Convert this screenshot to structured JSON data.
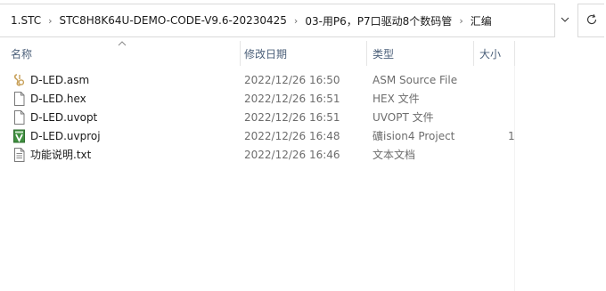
{
  "breadcrumb": {
    "items": [
      "1.STC",
      "STC8H8K64U-DEMO-CODE-V9.6-20230425",
      "03-用P6，P7口驱动8个数码管",
      "汇编"
    ],
    "separator": "›",
    "dropdown_icon": "chevron-down-icon",
    "refresh_icon": "refresh-icon"
  },
  "columns": {
    "name": "名称",
    "date": "修改日期",
    "type": "类型",
    "size": "大小",
    "sort_indicator": "sort-ascending-icon"
  },
  "files": [
    {
      "name": "D-LED.asm",
      "date": "2022/12/26 16:50",
      "type": "ASM Source File",
      "size": "",
      "icon": "asm-file-icon"
    },
    {
      "name": "D-LED.hex",
      "date": "2022/12/26 16:51",
      "type": "HEX 文件",
      "size": "",
      "icon": "blank-file-icon"
    },
    {
      "name": "D-LED.uvopt",
      "date": "2022/12/26 16:51",
      "type": "UVOPT 文件",
      "size": "",
      "icon": "blank-file-icon"
    },
    {
      "name": "D-LED.uvproj",
      "date": "2022/12/26 16:48",
      "type": "礦ision4 Project",
      "size": "1",
      "icon": "keil-project-icon"
    },
    {
      "name": "功能说明.txt",
      "date": "2022/12/26 16:46",
      "type": "文本文档",
      "size": "",
      "icon": "text-file-icon"
    }
  ],
  "colors": {
    "header_text": "#4c607a",
    "secondary_text": "#6d6d6d",
    "asm_icon": "#c8a15a",
    "keil_icon": "#3f8f3f"
  }
}
